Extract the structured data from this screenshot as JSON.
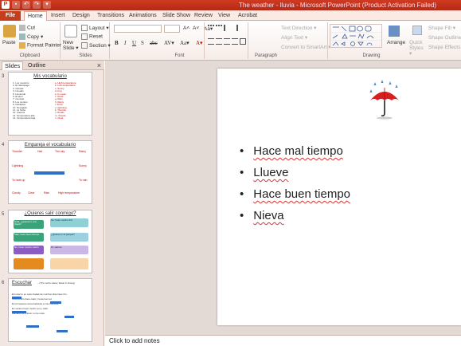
{
  "window": {
    "title": "The weather - lluvia - Microsoft PowerPoint (Product Activation Failed)",
    "app_letter": "P"
  },
  "tabs": [
    "File",
    "Home",
    "Insert",
    "Design",
    "Transitions",
    "Animations",
    "Slide Show",
    "Review",
    "View",
    "Acrobat"
  ],
  "ribbon": {
    "clipboard": {
      "paste": "Paste",
      "cut": "Cut",
      "copy": "Copy ▾",
      "format_painter": "Format Painter",
      "label": "Clipboard"
    },
    "slides": {
      "new_slide": "New Slide ▾",
      "layout": "Layout ▾",
      "reset": "Reset",
      "section": "Section ▾",
      "label": "Slides"
    },
    "font": {
      "grow": "A˄",
      "shrink": "A˅",
      "clear": "Aa▾",
      "bold": "B",
      "italic": "I",
      "underline": "U",
      "shadow": "S",
      "strike": "abc",
      "spacing": "AV▾",
      "case": "Aa▾",
      "color": "A▾",
      "label": "Font"
    },
    "paragraph": {
      "text_direction": "Text Direction ▾",
      "align_text": "Align Text ▾",
      "smartart": "Convert to SmartArt ▾",
      "label": "Paragraph"
    },
    "drawing": {
      "arrange": "Arrange",
      "quick_styles": "Quick Styles ▾",
      "shape_fill": "Shape Fill ▾",
      "shape_outline": "Shape Outline ▾",
      "shape_effects": "Shape Effects ▾",
      "label": "Drawing"
    }
  },
  "pane": {
    "tabs": [
      "Slides",
      "Outline"
    ],
    "close": "×",
    "thumbnails": [
      {
        "num": "3",
        "title": "Mis vocabulario",
        "left_items": [
          "1. Los nuestros",
          "2. El relámpago",
          "3. Calmas",
          "4. Llovado",
          "5. Lloviendo",
          "6. El ebor",
          "7. Conivas",
          "8. Los vientos",
          "9. Nublados",
          "10. Nevigada",
          "11. La Nube",
          "12. Cientos",
          "13. Temperatura alta",
          "14. Temperatura baja"
        ],
        "right_items": [
          "a. High temperature",
          "b. Low temperature",
          "c. Sunny",
          "d. Fog",
          "e. Is mean",
          "f. Cloud",
          "g. Rain",
          "h. Rainy",
          "i. Snow",
          "j. Lightning",
          "k. Thunder",
          "l. Clouds",
          "m. Clouds",
          "n. Clear"
        ]
      },
      {
        "num": "4",
        "title": "Empareja el vocabulario",
        "words": [
          "Thunder",
          "Hail",
          "The sky",
          "Rainy",
          "Lightning",
          "Sunny",
          "To heat up",
          "To rain",
          "Cloudy",
          "Clear",
          "Rain",
          "High temperature"
        ]
      },
      {
        "num": "5",
        "title": "¿Quieres salir conmigo?",
        "bubbles": [
          "Hola, ¿quieres ir a la playa?",
          "No, hace mucho frío",
          "Vale, hace buen tiempo",
          "¿Quieres ir al parque?",
          "No, hace mucho viento",
          "Sí, vamos"
        ]
      },
      {
        "num": "6",
        "title": "Escuchar",
        "subtitle": "– (The verbs Hacer,  Estar in Doing)",
        "lines": [
          "El invierno en esta ciudad de muchos días hace frío.",
          "Todo el año hace calor y tenemos sol.",
          "En primavera nieva bastante en la montaña.",
          "En verano hace mucho sol y calor.",
          "Mañana va a llover en la costa."
        ]
      }
    ]
  },
  "slide": {
    "bullets": [
      "Hace mal tiempo",
      "Llueve",
      "Hace buen tiempo",
      "Nieva"
    ],
    "image": "umbrella-rain"
  },
  "notes": {
    "placeholder": "Click to add notes"
  },
  "colors": {
    "accent": "#c43e1c",
    "red": "#d00000",
    "blue": "#1d5db6"
  }
}
